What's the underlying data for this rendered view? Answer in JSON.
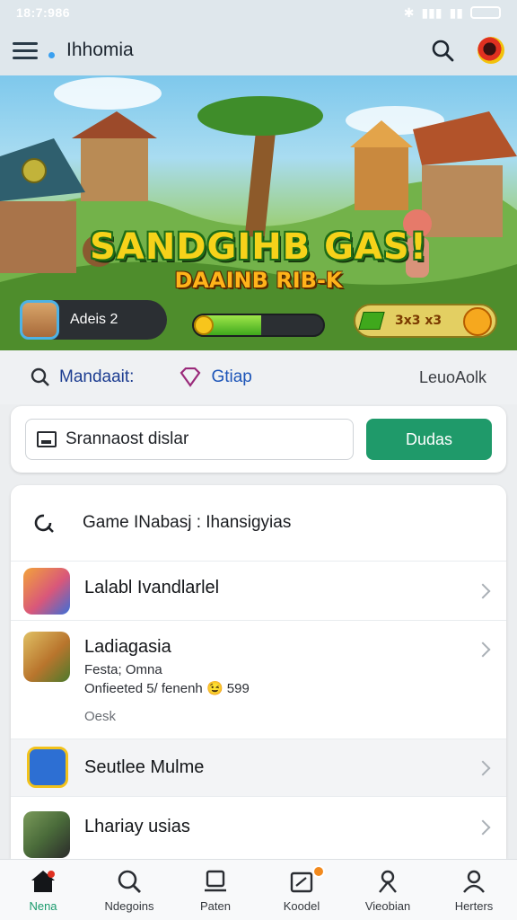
{
  "status_bar": {
    "time": "18:7:986"
  },
  "app_bar": {
    "title": "Ihhomia"
  },
  "hero": {
    "title": "SANDGIHB GAS!",
    "subtitle": "DAAINB RIB-K",
    "player_name": "Adeis 2",
    "xp_progress": 0.52,
    "gem_text": "3x3 x3"
  },
  "quick_tabs": [
    {
      "label": "Mandaait:",
      "icon": "search-icon"
    },
    {
      "label": "Gtiap",
      "icon": "diamond-icon"
    },
    {
      "label": "LeuoAolk",
      "icon": ""
    }
  ],
  "search": {
    "value": "Srannaost dislar",
    "button_label": "Dudas"
  },
  "list": {
    "header": "Game INabasj : Ihansigyias",
    "rows": [
      {
        "title": "Lalabl Ivandlarlel",
        "icon": "game-icon-hero",
        "icon_color": "#d9577a"
      },
      {
        "title": "Ladiagasia",
        "meta1": "Festa; Omna",
        "meta2": "Onfieeted 5/ fenenh 😉 599",
        "meta3": "Oesk",
        "icon": "game-icon-warrior",
        "icon_color": "#b9752d"
      },
      {
        "title": "Seutlee Mulme",
        "icon": "list-app-icon",
        "icon_color": "#2d6fd3"
      },
      {
        "title": "Lhariay usias",
        "icon": "game-icon-portrait",
        "icon_color": "#4a6b3a"
      }
    ]
  },
  "bottom_nav": [
    {
      "label": "Nena",
      "icon": "home-icon",
      "active": true
    },
    {
      "label": "Ndegoins",
      "icon": "search-icon",
      "active": false
    },
    {
      "label": "Paten",
      "icon": "layers-icon",
      "active": false
    },
    {
      "label": "Koodel",
      "icon": "edit-note-icon",
      "active": false,
      "badge": true
    },
    {
      "label": "Vieobian",
      "icon": "person-pin-icon",
      "active": false
    },
    {
      "label": "Herters",
      "icon": "profile-icon",
      "active": false
    }
  ],
  "colors": {
    "accent": "#1f9a6a",
    "link": "#1d55b8"
  }
}
